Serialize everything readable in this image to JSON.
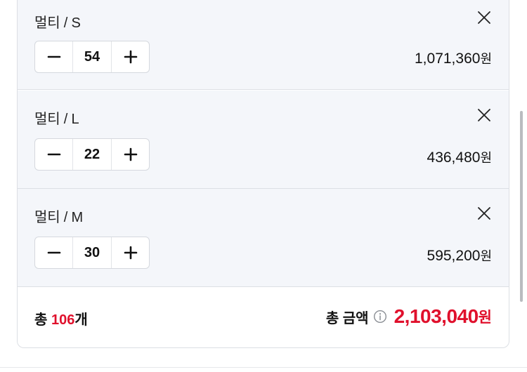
{
  "items": [
    {
      "option": "멀티 / S",
      "quantity": "54",
      "price": "1,071,360",
      "currency": "원"
    },
    {
      "option": "멀티 / L",
      "quantity": "22",
      "price": "436,480",
      "currency": "원"
    },
    {
      "option": "멀티 / M",
      "quantity": "30",
      "price": "595,200",
      "currency": "원"
    }
  ],
  "summary": {
    "count_prefix": "총 ",
    "count": "106",
    "count_suffix": "개",
    "amount_label": "총 금액",
    "amount": "2,103,040",
    "currency": "원"
  },
  "icons": {
    "close": "close-icon",
    "minus": "minus-icon",
    "plus": "plus-icon",
    "info": "info-icon"
  },
  "colors": {
    "accent": "#e0102c",
    "item_background": "#f4f6fa",
    "border": "#dcdfe4"
  }
}
